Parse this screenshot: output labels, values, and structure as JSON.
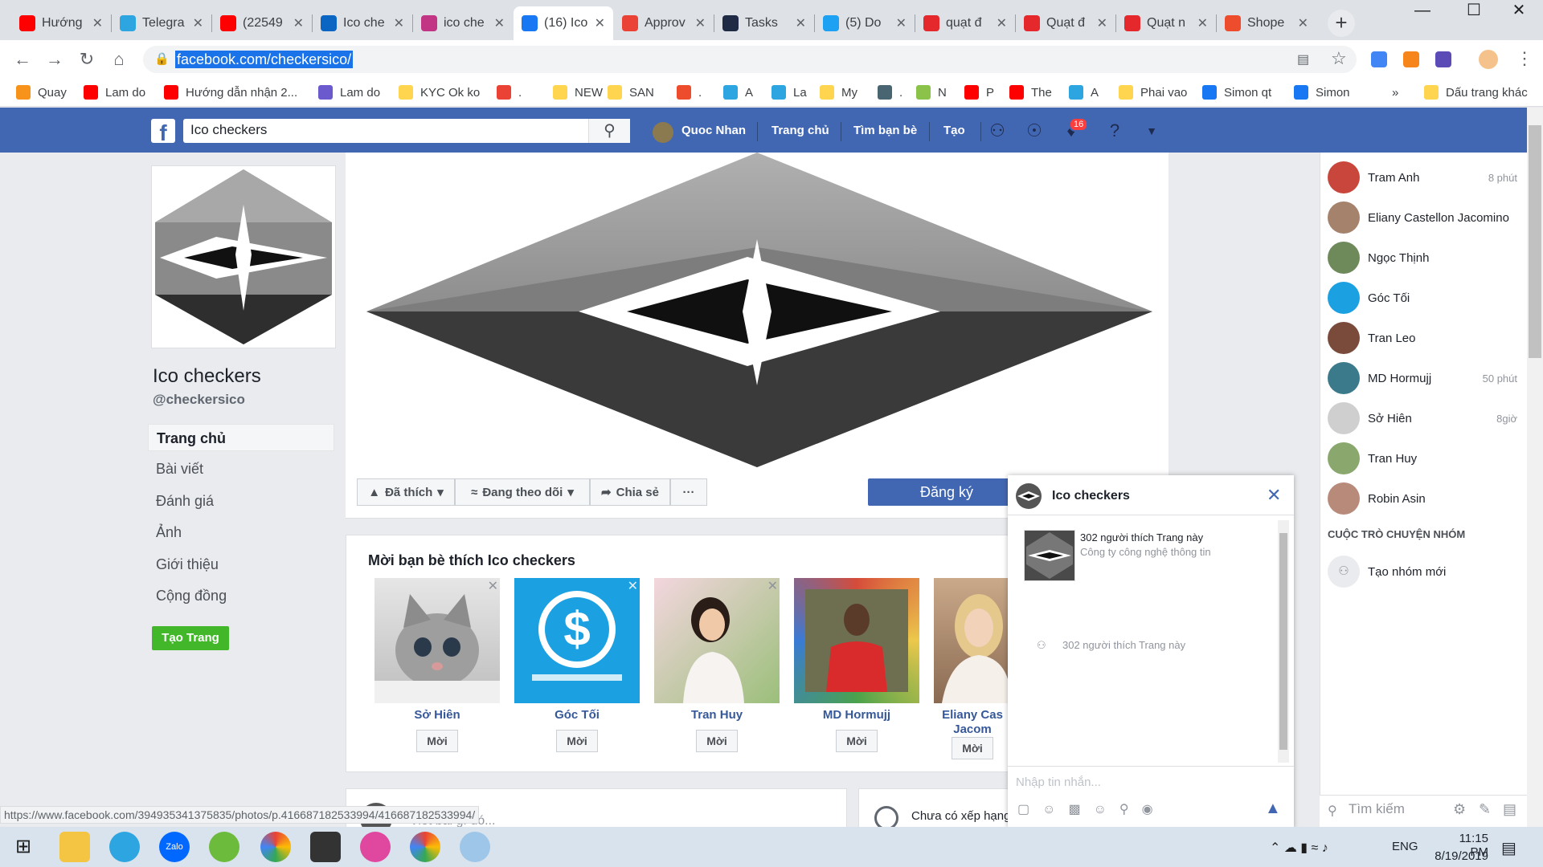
{
  "browser": {
    "tabs": [
      {
        "title": "Hướng",
        "color": "#ff0000"
      },
      {
        "title": "Telegra",
        "color": "#2ca5e0"
      },
      {
        "title": "(22549",
        "color": "#ff0000"
      },
      {
        "title": "Ico che",
        "color": "#0a66c2"
      },
      {
        "title": "ico che",
        "color": "#c13584"
      },
      {
        "title": "(16) Ico",
        "color": "#1877f2"
      },
      {
        "title": "Approv",
        "color": "#ea4335"
      },
      {
        "title": "Tasks",
        "color": "#1f2a44"
      },
      {
        "title": "(5) Do",
        "color": "#1da1f2"
      },
      {
        "title": "quạt đ",
        "color": "#e4282c"
      },
      {
        "title": "Quạt đ",
        "color": "#e4282c"
      },
      {
        "title": "Quạt n",
        "color": "#e4282c"
      },
      {
        "title": "Shope",
        "color": "#ee4d2d"
      }
    ],
    "new_tab": "+",
    "url": "facebook.com/checkersico/",
    "bookmarks": [
      {
        "label": "Quay",
        "color": "#f7931a"
      },
      {
        "label": "Lam do",
        "color": "#ff0000"
      },
      {
        "label": "Hướng dẫn nhận 2...",
        "color": "#ff0000"
      },
      {
        "label": "Lam do",
        "color": "#6a5acd"
      },
      {
        "label": "KYC Ok ko",
        "color": "#ffd54f"
      },
      {
        "label": ".",
        "color": "#ea4335"
      },
      {
        "label": "NEW",
        "color": "#ffd54f"
      },
      {
        "label": "SAN",
        "color": "#ffd54f"
      },
      {
        "label": ".",
        "color": "#ee4d2d"
      },
      {
        "label": "A",
        "color": "#2ca5e0"
      },
      {
        "label": "La",
        "color": "#2ca5e0"
      },
      {
        "label": "My",
        "color": "#ffd54f"
      },
      {
        "label": ".",
        "color": "#4a6572"
      },
      {
        "label": "N",
        "color": "#8bc34a"
      },
      {
        "label": "P",
        "color": "#ff0000"
      },
      {
        "label": "The",
        "color": "#ff0000"
      },
      {
        "label": "A",
        "color": "#2ca5e0"
      },
      {
        "label": "Phai vao",
        "color": "#ffd54f"
      },
      {
        "label": "Simon qt",
        "color": "#1877f2"
      },
      {
        "label": "Simon",
        "color": "#1877f2"
      }
    ],
    "bookmarks_more": "»",
    "other_bookmarks": "Dấu trang khác",
    "status_url": "https://www.facebook.com/394935341375835/photos/p.416687182533994/416687182533994/"
  },
  "fb_header": {
    "search_value": "Ico checkers",
    "profile_name": "Quoc Nhan",
    "nav_home": "Trang chủ",
    "nav_find_friends": "Tìm bạn bè",
    "nav_create": "Tạo",
    "notif_count": "16"
  },
  "page": {
    "name": "Ico checkers",
    "handle": "@checkersico",
    "nav": [
      "Trang chủ",
      "Bài viết",
      "Đánh giá",
      "Ảnh",
      "Giới thiệu",
      "Cộng đồng"
    ],
    "create_page": "Tạo Trang",
    "liked_btn": "Đã thích",
    "following_btn": "Đang theo dõi",
    "share_btn": "Chia sẻ",
    "more_btn": "···",
    "register_btn": "Đăng ký"
  },
  "invite": {
    "title": "Mời bạn bè thích Ico checkers",
    "invite_label": "Mời",
    "friends": [
      {
        "name": "Sở Hiên"
      },
      {
        "name": "Góc Tối"
      },
      {
        "name": "Tran Huy"
      },
      {
        "name": "MD Hormujj"
      },
      {
        "name": "Eliany Cas",
        "name2": "Jacom"
      }
    ]
  },
  "composer": {
    "placeholder": "Viết bài gì đó...",
    "rating_text": "Chưa có xếp hạng"
  },
  "chat_popup": {
    "title": "Ico checkers",
    "likes": "302 người thích Trang này",
    "category": "Công ty công nghệ thông tin",
    "likes2": "302 người thích Trang này",
    "input_placeholder": "Nhập tin nhắn..."
  },
  "chat_sidebar": {
    "friends": [
      {
        "name": "Tram Anh",
        "time": "8 phút"
      },
      {
        "name": "Eliany Castellon Jacomino",
        "time": ""
      },
      {
        "name": "Ngọc Thịnh",
        "time": ""
      },
      {
        "name": "Góc Tối",
        "time": ""
      },
      {
        "name": "Tran Leo",
        "time": ""
      },
      {
        "name": "MD Hormujj",
        "time": "50 phút"
      },
      {
        "name": "Sở Hiên",
        "time": "8giờ"
      },
      {
        "name": "Tran Huy",
        "time": ""
      },
      {
        "name": "Robin Asin",
        "time": ""
      }
    ],
    "group_heading": "CUỘC TRÒ CHUYỆN NHÓM",
    "new_group": "Tạo nhóm mới",
    "search_placeholder": "Tìm kiếm"
  },
  "taskbar": {
    "lang": "ENG",
    "time": "11:15 PM",
    "date": "8/19/2019"
  }
}
